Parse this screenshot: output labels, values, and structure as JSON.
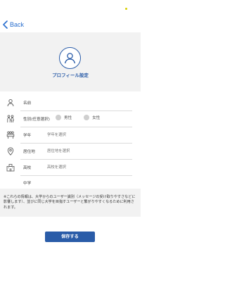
{
  "nav": {
    "back_label": "Back"
  },
  "profile": {
    "title": "プロフィール設定"
  },
  "form": {
    "name_label": "名前",
    "gender_label": "性別(任意選択)",
    "gender_options": [
      "男性",
      "女性"
    ],
    "grade_label": "学年",
    "grade_placeholder": "学年を選択",
    "residence_label": "居住地",
    "residence_placeholder": "居住地を選択",
    "high_school_label": "高校",
    "high_school_placeholder": "高校を選択",
    "middle_school_label": "中学"
  },
  "notice": {
    "text": "※これらの情報は、大学からのユーザー識別（メッセージの受け取りやすさなどに影響します）、並びに同じ大学を目指すユーザーと繋がりやすくなるために利用されます。"
  },
  "actions": {
    "save_label": "保存する"
  },
  "colors": {
    "accent": "#2a5ca8",
    "back_link": "#2a6fcf",
    "band": "#f2f2f2"
  }
}
